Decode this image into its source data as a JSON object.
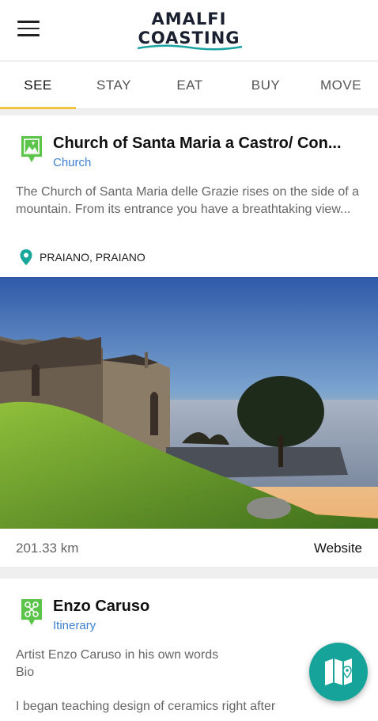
{
  "app": {
    "logo_line1": "AMALFI",
    "logo_line2": "COASTING"
  },
  "tabs": [
    {
      "label": "SEE",
      "active": true
    },
    {
      "label": "STAY",
      "active": false
    },
    {
      "label": "EAT",
      "active": false
    },
    {
      "label": "BUY",
      "active": false
    },
    {
      "label": "MOVE",
      "active": false
    }
  ],
  "cards": [
    {
      "title": "Church of Santa Maria a Castro/ Con...",
      "category": "Church",
      "category_icon": "church-landscape-icon",
      "description": "The Church of Santa Maria delle Grazie rises on the side of a mountain. From its entrance you have a breathtaking view...",
      "location": "PRAIANO, PRAIANO",
      "distance": "201.33 km",
      "website_label": "Website"
    },
    {
      "title": "Enzo Caruso",
      "category": "Itinerary",
      "category_icon": "itinerary-grid-icon",
      "description_line1": "Artist Enzo Caruso in his own words",
      "description_line2": "Bio",
      "description_line3": "I began teaching design of ceramics right after"
    }
  ],
  "colors": {
    "accent": "#f2c440",
    "category_link": "#3d7fd1",
    "icon_green": "#5cc44a",
    "fab": "#16a49a",
    "pin": "#19a79c"
  },
  "fab": {
    "icon": "map-icon"
  }
}
